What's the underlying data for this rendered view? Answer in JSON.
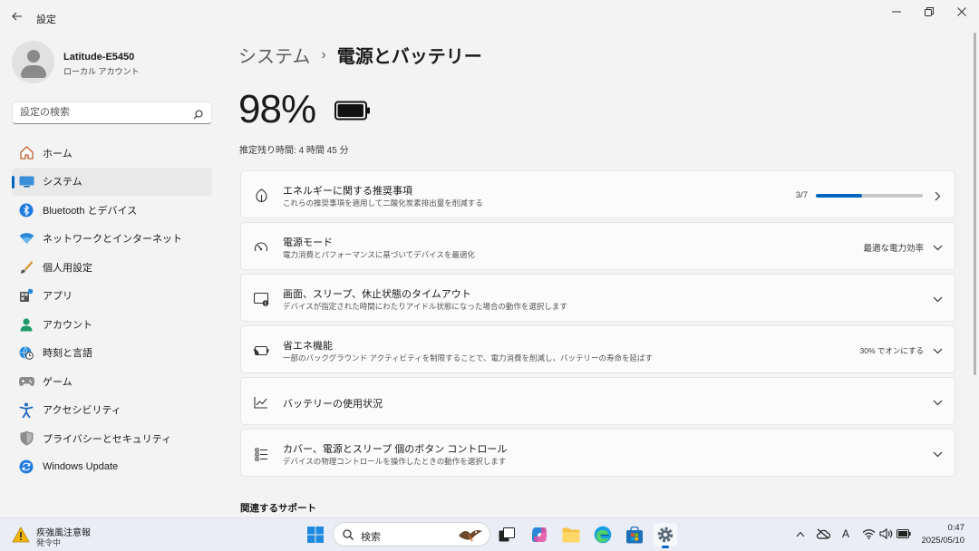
{
  "window": {
    "title": "設定",
    "controls": [
      "minimize",
      "restore",
      "close"
    ]
  },
  "profile": {
    "name": "Latitude-E5450",
    "account_type": "ローカル アカウント"
  },
  "search": {
    "placeholder": "設定の検索"
  },
  "sidebar": {
    "items": [
      {
        "label": "ホーム",
        "icon": "home-icon"
      },
      {
        "label": "システム",
        "icon": "system-icon",
        "active": true
      },
      {
        "label": "Bluetooth とデバイス",
        "icon": "bluetooth-icon"
      },
      {
        "label": "ネットワークとインターネット",
        "icon": "network-icon"
      },
      {
        "label": "個人用設定",
        "icon": "brush-icon"
      },
      {
        "label": "アプリ",
        "icon": "apps-icon"
      },
      {
        "label": "アカウント",
        "icon": "account-icon"
      },
      {
        "label": "時刻と言語",
        "icon": "globe-clock-icon"
      },
      {
        "label": "ゲーム",
        "icon": "gamepad-icon"
      },
      {
        "label": "アクセシビリティ",
        "icon": "accessibility-icon"
      },
      {
        "label": "プライバシーとセキュリティ",
        "icon": "shield-icon"
      },
      {
        "label": "Windows Update",
        "icon": "update-icon"
      }
    ]
  },
  "breadcrumb": {
    "parent": "システム",
    "separator": "›",
    "current": "電源とバッテリー"
  },
  "battery": {
    "percent_text": "98%",
    "level": 0.98,
    "estimate_label": "推定残り時間: ",
    "estimate_value": "4 時間 45 分"
  },
  "cards": [
    {
      "title": "エネルギーに関する推奨事項",
      "subtitle": "これらの推奨事項を適用して二酸化炭素排出量を削減する",
      "progress_text": "3/7",
      "progress": 0.43,
      "icon": "leaf-icon"
    },
    {
      "title": "電源モード",
      "subtitle": "電力消費とパフォーマンスに基づいてデバイスを最適化",
      "value": "最適な電力効率",
      "icon": "power-mode-icon"
    },
    {
      "title": "画面、スリープ、休止状態のタイムアウト",
      "subtitle": "デバイスが指定された時間にわたりアイドル状態になった場合の動作を選択します",
      "icon": "screen-sleep-icon"
    },
    {
      "title": "省エネ機能",
      "subtitle": "一部のバックグラウンド アクティビティを制限することで、電力消費を削減し、バッテリーの寿命を延ばす",
      "value": "30% でオンにする",
      "icon": "battery-saver-icon"
    },
    {
      "title": "バッテリーの使用状況",
      "icon": "chart-icon"
    },
    {
      "title": "カバー、電源とスリープ 個のボタン コントロール",
      "subtitle": "デバイスの物理コントロールを操作したときの動作を選択します",
      "icon": "buttons-list-icon"
    }
  ],
  "related": {
    "heading": "関連するサポート"
  },
  "taskbar": {
    "weather_title": "疾強風注意報",
    "weather_sub": "発令中",
    "search_text": "検索",
    "time": "0:47",
    "date": "2025/05/10",
    "ime_indicator": "A"
  },
  "colors": {
    "accent": "#0067c0",
    "background": "#f3f3f3",
    "card": "#fbfbfb"
  }
}
